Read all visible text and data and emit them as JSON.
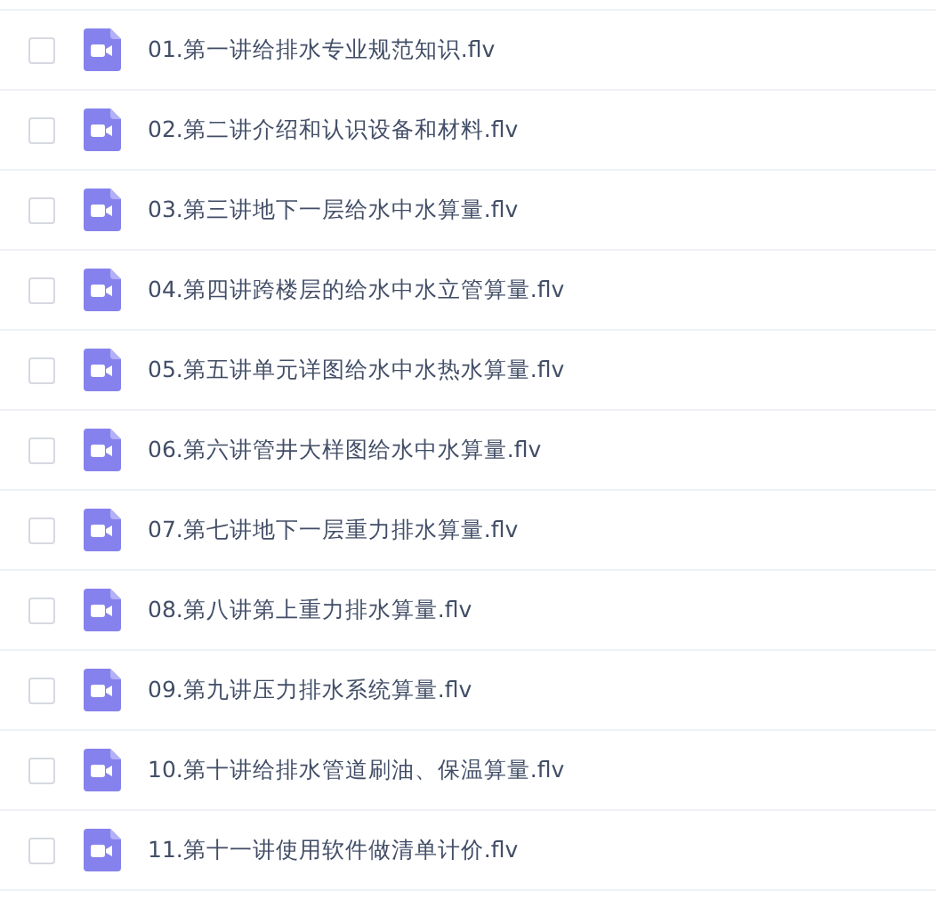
{
  "files": [
    {
      "name": "01.第一讲给排水专业规范知识.flv",
      "checked": false
    },
    {
      "name": "02.第二讲介绍和认识设备和材料.flv",
      "checked": false
    },
    {
      "name": "03.第三讲地下一层给水中水算量.flv",
      "checked": false
    },
    {
      "name": "04.第四讲跨楼层的给水中水立管算量.flv",
      "checked": false
    },
    {
      "name": "05.第五讲单元详图给水中水热水算量.flv",
      "checked": false
    },
    {
      "name": "06.第六讲管井大样图给水中水算量.flv",
      "checked": false
    },
    {
      "name": "07.第七讲地下一层重力排水算量.flv",
      "checked": false
    },
    {
      "name": "08.第八讲第上重力排水算量.flv",
      "checked": false
    },
    {
      "name": "09.第九讲压力排水系统算量.flv",
      "checked": false
    },
    {
      "name": "10.第十讲给排水管道刷油、保温算量.flv",
      "checked": false
    },
    {
      "name": "11.第十一讲使用软件做清单计价.flv",
      "checked": false
    }
  ]
}
